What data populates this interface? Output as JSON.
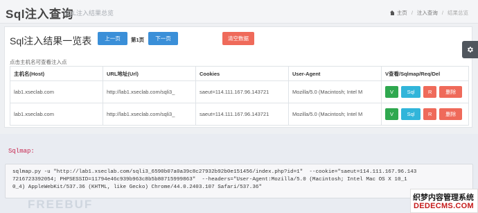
{
  "header": {
    "title": "Sql注入查询",
    "subtitle": "SQL注入结果总览",
    "breadcrumb": [
      "主页",
      "注入查询",
      "结果总览"
    ]
  },
  "list": {
    "title": "Sql注入结果一览表",
    "prev_label": "上一页",
    "page_label": "第1页",
    "next_label": "下一页",
    "clear_label": "清空数据",
    "hint": "点击主机名可查看注入点",
    "columns": [
      "主机名(Host)",
      "URL地址(Url)",
      "Cookies",
      "User-Agent",
      "V查看/Sqlmap/Req/Del"
    ],
    "rows": [
      {
        "host": "lab1.xseclab.com",
        "url": "http://lab1.xseclab.com/sqli3_",
        "cookies": "saeut=114.111.167.96.143721",
        "ua": "Mozilla/5.0 (Macintosh; Intel M",
        "actions": [
          "V",
          "Sql",
          "R",
          "删除"
        ]
      },
      {
        "host": "lab1.xseclab.com",
        "url": "http://lab1.xseclab.com/sqli3_",
        "cookies": "saeut=114.111.167.96.143721",
        "ua": "Mozilla/5.0 (Macintosh; Intel M",
        "actions": [
          "V",
          "Sql",
          "R",
          "删除"
        ]
      }
    ]
  },
  "sqlmap": {
    "label": "Sqlmap:",
    "command_lines": [
      "sqlmap.py -u \"http://lab1.xseclab.com/sqli3_6590b07a0a39c8c27932b92b0e151456/index.php?id=1\"  --cookie=\"saeut=114.111.167.96.143",
      "7216723392054; PHPSESSID=11794e46c939b963c8b5b80715999863\"  --headers=\"User-Agent:Mozilla/5.0 (Macintosh; Intel Mac OS X 10_1",
      "0_4) AppleWebKit/537.36 (KHTML, like Gecko) Chrome/44.0.2403.107 Safari/537.36\""
    ]
  },
  "watermark": "FREEBUF",
  "corner_badge": {
    "line1": "织梦内容管理系统",
    "line2": "DEDECMS.COM"
  },
  "colors": {
    "primary": "#3a8fd8",
    "danger": "#ef6a5a",
    "success": "#2fa84f",
    "info": "#31b5da"
  },
  "icons": [
    "home-icon",
    "gear-icon"
  ]
}
